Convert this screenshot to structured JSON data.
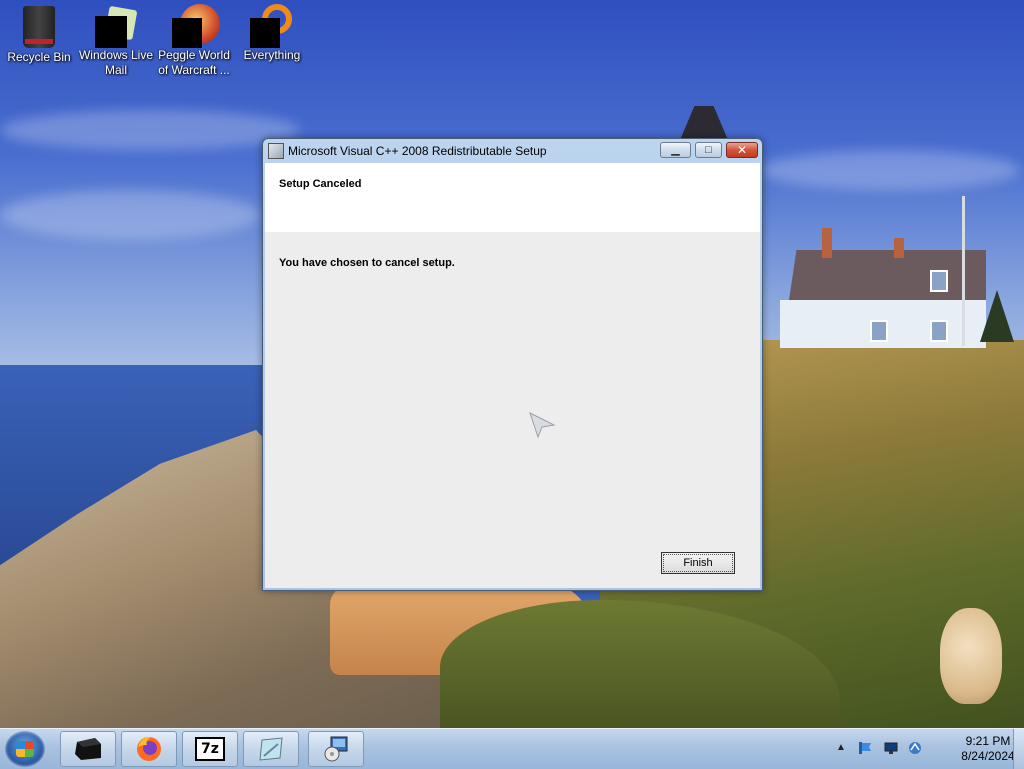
{
  "desktop": {
    "icons": [
      {
        "label_line1": "Recycle Bin",
        "label_line2": "",
        "icon": "recycle-bin-icon"
      },
      {
        "label_line1": "Windows Live",
        "label_line2": "Mail",
        "icon": "windows-live-mail-icon"
      },
      {
        "label_line1": "Peggle World",
        "label_line2": "of Warcraft ...",
        "icon": "peggle-icon"
      },
      {
        "label_line1": "Everything",
        "label_line2": "",
        "icon": "everything-search-icon"
      }
    ]
  },
  "dialog": {
    "title": "Microsoft Visual C++ 2008 Redistributable Setup",
    "banner_title": "Setup Canceled",
    "message": "You have chosen to cancel setup.",
    "finish_label": "Finish",
    "controls": {
      "minimize": "minimize-icon",
      "maximize": "maximize-icon",
      "close": "close-icon"
    }
  },
  "taskbar": {
    "start_icon": "windows-start-icon",
    "pinned": [
      {
        "name": "media-app",
        "icon": "black-box-icon"
      },
      {
        "name": "firefox",
        "icon": "firefox-icon"
      },
      {
        "name": "7zip",
        "text": "7z",
        "icon": "7zip-icon"
      },
      {
        "name": "notepad",
        "icon": "notepad-icon"
      },
      {
        "name": "setup",
        "icon": "setup-installer-icon"
      }
    ],
    "tray": {
      "time": "9:21 PM",
      "date": "8/24/2024",
      "icons": [
        "show-hidden-icons-chevron",
        "flag-icon",
        "display-icon",
        "network-icon"
      ]
    }
  },
  "colors": {
    "titlebar": "#bcd4ee",
    "close_button": "#c23b22",
    "dialog_client": "#ededed",
    "taskbar": "#a9c2e0"
  }
}
